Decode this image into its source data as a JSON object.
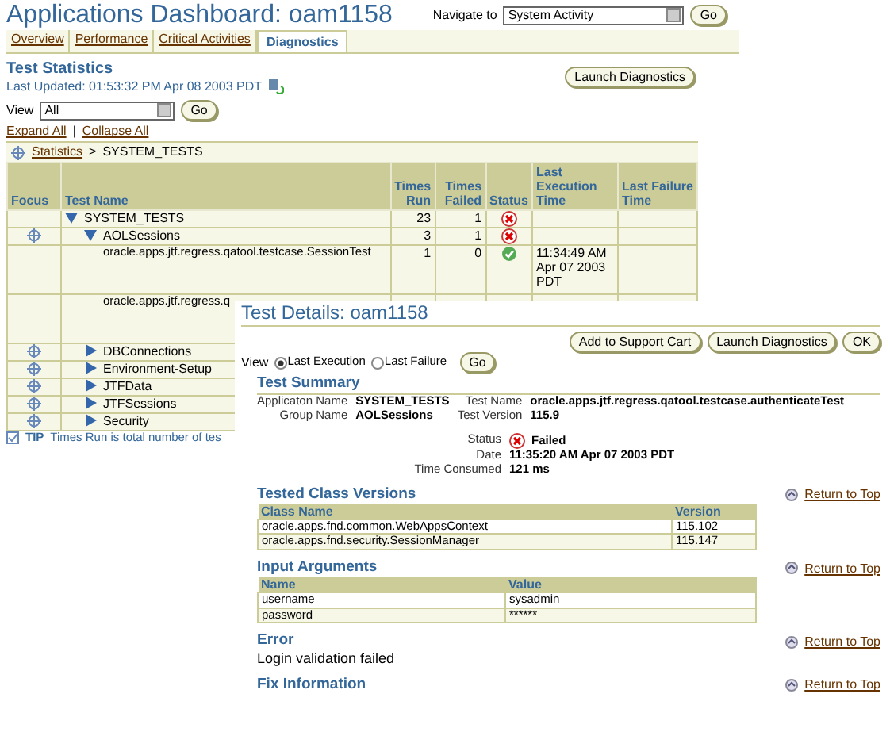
{
  "header": {
    "title": "Applications Dashboard: oam1158",
    "navigate_label": "Navigate to",
    "navigate_value": "System Activity",
    "go": "Go"
  },
  "tabs": [
    {
      "label": "Overview",
      "selected": false
    },
    {
      "label": "Performance",
      "selected": false
    },
    {
      "label": "Critical Activities",
      "selected": false
    },
    {
      "label": "Diagnostics",
      "selected": true
    }
  ],
  "statistics": {
    "heading": "Test Statistics",
    "last_updated": "Last Updated: 01:53:32 PM Apr 08 2003 PDT",
    "launch_button": "Launch Diagnostics",
    "view_label": "View",
    "view_value": "All",
    "go": "Go",
    "expand_all": "Expand All",
    "separator": "|",
    "collapse_all": "Collapse All",
    "breadcrumb_link": "Statistics",
    "breadcrumb_sep": ">",
    "breadcrumb_current": "SYSTEM_TESTS",
    "columns": [
      "Focus",
      "Test Name",
      "Times Run",
      "Times Failed",
      "Status",
      "Last Execution Time",
      "Last Failure Time"
    ],
    "rows": [
      {
        "kind": "group",
        "focus": false,
        "name": "SYSTEM_TESTS",
        "expanded": true,
        "times_run": "23",
        "times_failed": "1",
        "failed": true,
        "children": [
          {
            "kind": "group",
            "focus": true,
            "name": "AOLSessions",
            "expanded": true,
            "times_run": "3",
            "times_failed": "1",
            "failed": true,
            "children": [
              {
                "kind": "test",
                "focus": false,
                "name": "oracle.apps.jtf.regress.qatool.testcase.SessionTest",
                "times_run": "1",
                "times_failed": "0",
                "failed": false,
                "last_execution": "11:34:49 AM Apr 07 2003 PDT"
              },
              {
                "kind": "test",
                "focus": false,
                "name": "oracle.apps.jtf.regress.q"
              }
            ]
          },
          {
            "kind": "group",
            "focus": true,
            "name": "DBConnections",
            "expanded": false
          },
          {
            "kind": "group",
            "focus": true,
            "name": "Environment-Setup",
            "expanded": false
          },
          {
            "kind": "group",
            "focus": true,
            "name": "JTFData",
            "expanded": false
          },
          {
            "kind": "group",
            "focus": true,
            "name": "JTFSessions",
            "expanded": false
          },
          {
            "kind": "group",
            "focus": true,
            "name": "Security",
            "expanded": false
          }
        ]
      }
    ],
    "tip_label": "TIP",
    "tip_text": "Times Run is total number of tes"
  },
  "details": {
    "title": "Test Details: oam1158",
    "buttons": [
      "Add to Support Cart",
      "Launch Diagnostics",
      "OK"
    ],
    "view_label": "View",
    "view_options": [
      {
        "label": "Last Execution",
        "selected": true
      },
      {
        "label": "Last Failure",
        "selected": false
      }
    ],
    "go": "Go",
    "summary_heading": "Test Summary",
    "summary": [
      {
        "label": "Applicaton Name",
        "value": "SYSTEM_TESTS"
      },
      {
        "label": "Test Name",
        "value": "oracle.apps.jtf.regress.qatool.testcase.authenticateTest"
      },
      {
        "label": "Group Name",
        "value": "AOLSessions"
      },
      {
        "label": "Test Version",
        "value": "115.9"
      }
    ],
    "results": [
      {
        "label": "Status",
        "value": "Failed",
        "failed": true
      },
      {
        "label": "Date",
        "value": "11:35:20 AM Apr 07 2003 PDT"
      },
      {
        "label": "Time Consumed",
        "value": "121 ms"
      }
    ],
    "sections": [
      {
        "kind": "table",
        "heading": "Tested Class Versions",
        "return_link": "Return to Top",
        "columns": [
          "Class Name",
          "Version"
        ],
        "rows": [
          [
            "oracle.apps.fnd.common.WebAppsContext",
            "115.102"
          ],
          [
            "oracle.apps.fnd.security.SessionManager",
            "115.147"
          ]
        ]
      },
      {
        "kind": "table",
        "heading": "Input Arguments",
        "return_link": "Return to Top",
        "columns": [
          "Name",
          "Value"
        ],
        "rows": [
          [
            "username",
            "sysadmin"
          ],
          [
            "password",
            "******"
          ]
        ]
      },
      {
        "kind": "text",
        "heading": "Error",
        "return_link": "Return to Top",
        "text": "Login validation failed"
      },
      {
        "kind": "text",
        "heading": "Fix Information",
        "return_link": "Return to Top"
      }
    ]
  }
}
